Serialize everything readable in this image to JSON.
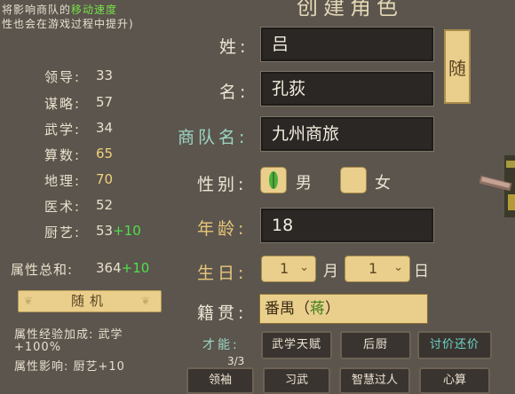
{
  "title": "创建角色",
  "hints": {
    "line1_prefix": "将影响商队的",
    "line1_highlight": "移动速度",
    "line2": "性也会在游戏过程中提升)"
  },
  "stats": [
    {
      "label": "领导:",
      "value": "33",
      "bonus": ""
    },
    {
      "label": "谋略:",
      "value": "57",
      "bonus": ""
    },
    {
      "label": "武学:",
      "value": "34",
      "bonus": ""
    },
    {
      "label": "算数:",
      "value": "65",
      "bonus": ""
    },
    {
      "label": "地理:",
      "value": "70",
      "bonus": ""
    },
    {
      "label": "医术:",
      "value": "52",
      "bonus": ""
    },
    {
      "label": "厨艺:",
      "value": "53",
      "bonus": "+10"
    }
  ],
  "total": {
    "label": "属性总和:",
    "value": "364",
    "bonus": "+10"
  },
  "random_button": "随机",
  "bonus_info": {
    "line1": "属性经验加成: 武学",
    "line2": "+100%",
    "line3": "属性影响: 厨艺+10"
  },
  "form": {
    "surname_label": "姓:",
    "surname_value": "吕",
    "name_label": "名:",
    "name_value": "孔荻",
    "caravan_label": "商队名:",
    "caravan_value": "九州商旅",
    "gender_label": "性别:",
    "gender_male": "男",
    "gender_female": "女",
    "gender_selected": "male",
    "age_label": "年龄:",
    "age_value": "18",
    "birthday_label": "生日:",
    "month_value": "1",
    "month_unit": "月",
    "day_value": "1",
    "day_unit": "日",
    "origin_label": "籍贯:",
    "origin_value_prefix": "番禺（",
    "origin_value_highlight": "蒋",
    "origin_value_suffix": "）",
    "random_side_button": "随"
  },
  "talents": {
    "label": "才能:",
    "count": "3/3",
    "items": [
      "武学天赋",
      "后厨",
      "讨价还价"
    ]
  },
  "bottom_tabs": [
    "领袖",
    "习武",
    "智慧过人",
    "心算"
  ],
  "colors": {
    "background": "#5b554d",
    "field_bg": "#2a2724",
    "gold_button": "#e9cf8b",
    "highlight_green": "#4fe04a"
  }
}
